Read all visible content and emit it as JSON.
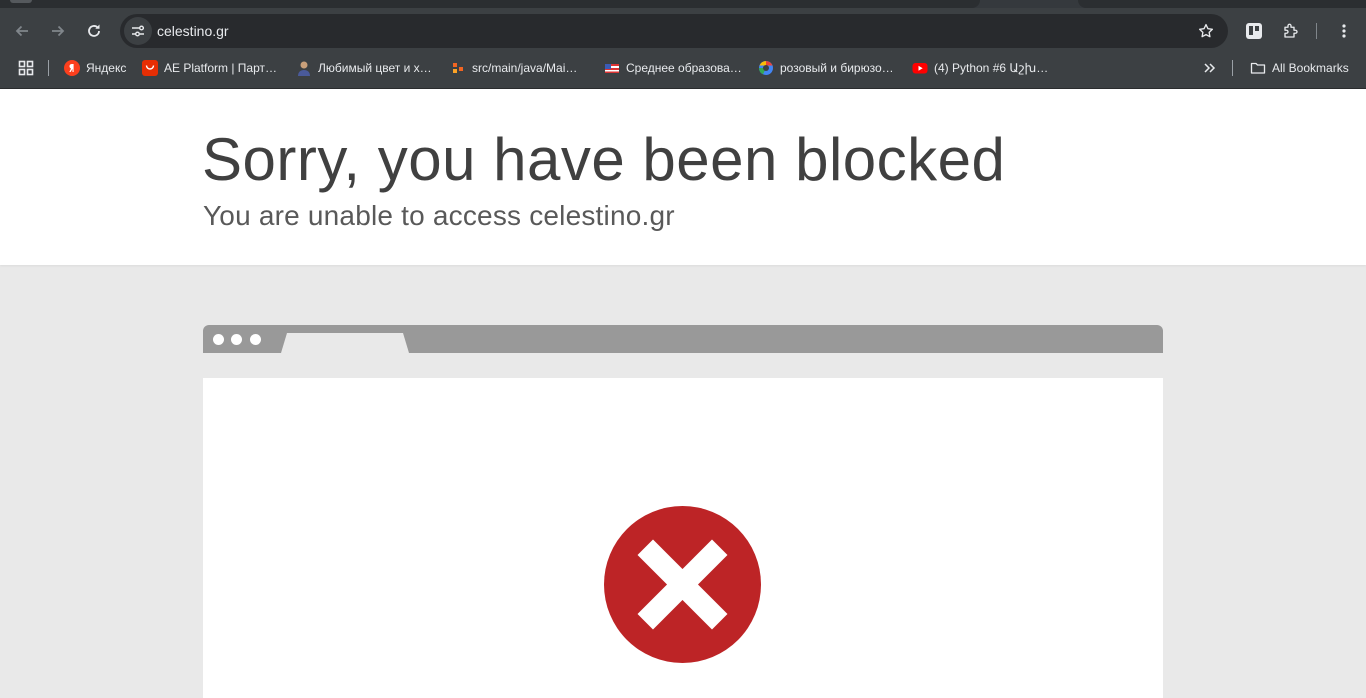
{
  "browser": {
    "url": "celestino.gr",
    "bookmarks": [
      {
        "label": "Яндекс",
        "icon": "yandex-icon"
      },
      {
        "label": "AE Platform | Парт…",
        "icon": "aliexpress-icon"
      },
      {
        "label": "Любимый цвет и х…",
        "icon": "person-icon"
      },
      {
        "label": "src/main/java/Mai…",
        "icon": "gitlab-icon"
      },
      {
        "label": "Среднее образова…",
        "icon": "flag-icon"
      },
      {
        "label": "розовый и бирюзо…",
        "icon": "google-icon"
      },
      {
        "label": "(4) Python #6 Աշխ…",
        "icon": "youtube-icon"
      }
    ],
    "all_bookmarks_label": "All Bookmarks"
  },
  "page": {
    "title": "Sorry, you have been blocked",
    "subtitle": "You are unable to access celestino.gr"
  },
  "colors": {
    "error_red": "#bd2426",
    "chrome_bg": "#3c4043",
    "mock_bar": "#999999"
  }
}
